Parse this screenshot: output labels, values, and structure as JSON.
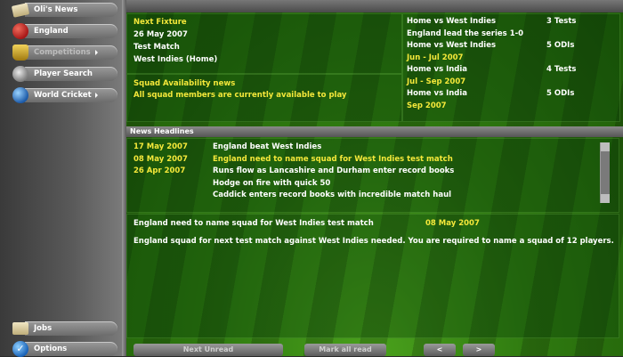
{
  "sidebar": {
    "items": [
      {
        "label": "Oli's News",
        "icon": "newspaper-icon",
        "dim": false
      },
      {
        "label": "England",
        "icon": "cricket-ball-icon",
        "dim": false
      },
      {
        "label": "Competitions",
        "icon": "trophy-icon",
        "dim": true
      },
      {
        "label": "Player Search",
        "icon": "magnifier-icon",
        "dim": false
      },
      {
        "label": "World Cricket",
        "icon": "globe-icon",
        "dim": false
      }
    ],
    "bottom": [
      {
        "label": "Jobs",
        "icon": "scroll-icon"
      },
      {
        "label": "Options",
        "icon": "checkmark-icon"
      }
    ]
  },
  "fixture": {
    "heading": "Next Fixture",
    "date": "26 May 2007",
    "type": "Test Match",
    "opponent": "West Indies (Home)"
  },
  "availability": {
    "heading": "Squad Availability news",
    "message": "All squad members are currently available to play"
  },
  "series": [
    {
      "left": "Home vs West Indies",
      "right": "3 Tests",
      "left_yellow": false
    },
    {
      "left": "England lead the series 1-0",
      "right": "",
      "left_yellow": false
    },
    {
      "left": "Home vs West Indies",
      "right": "5 ODIs",
      "left_yellow": false
    },
    {
      "left": "Jun - Jul 2007",
      "right": "",
      "left_yellow": true
    },
    {
      "left": "Home vs India",
      "right": "4 Tests",
      "left_yellow": false
    },
    {
      "left": "Jul - Sep 2007",
      "right": "",
      "left_yellow": true
    },
    {
      "left": "Home vs India",
      "right": "5 ODIs",
      "left_yellow": false
    },
    {
      "left": "Sep 2007",
      "right": "",
      "left_yellow": true
    }
  ],
  "news": {
    "section_title": "News Headlines",
    "rows": [
      {
        "date": "17 May 2007",
        "headline": "England beat West Indies",
        "highlight": false
      },
      {
        "date": "08 May 2007",
        "headline": "England need to name squad for West Indies test match",
        "highlight": true
      },
      {
        "date": "26 Apr 2007",
        "headline": "Runs flow as Lancashire and Durham enter record books",
        "highlight": false
      },
      {
        "date": "",
        "headline": "Hodge on fire with quick 50",
        "highlight": false
      },
      {
        "date": "",
        "headline": "Caddick enters record books with incredible match haul",
        "highlight": false
      }
    ]
  },
  "article": {
    "title": "England need to name squad for West Indies test match",
    "date": "08 May 2007",
    "body": "England squad for next test match against West Indies needed. You are required to name a squad of 12 players."
  },
  "buttons": {
    "next_unread": "Next Unread",
    "mark_all_read": "Mark all read",
    "prev": "<",
    "next": ">"
  },
  "colors": {
    "highlight_text": "#f5e83a",
    "pitch_green": "#2f7a10"
  }
}
